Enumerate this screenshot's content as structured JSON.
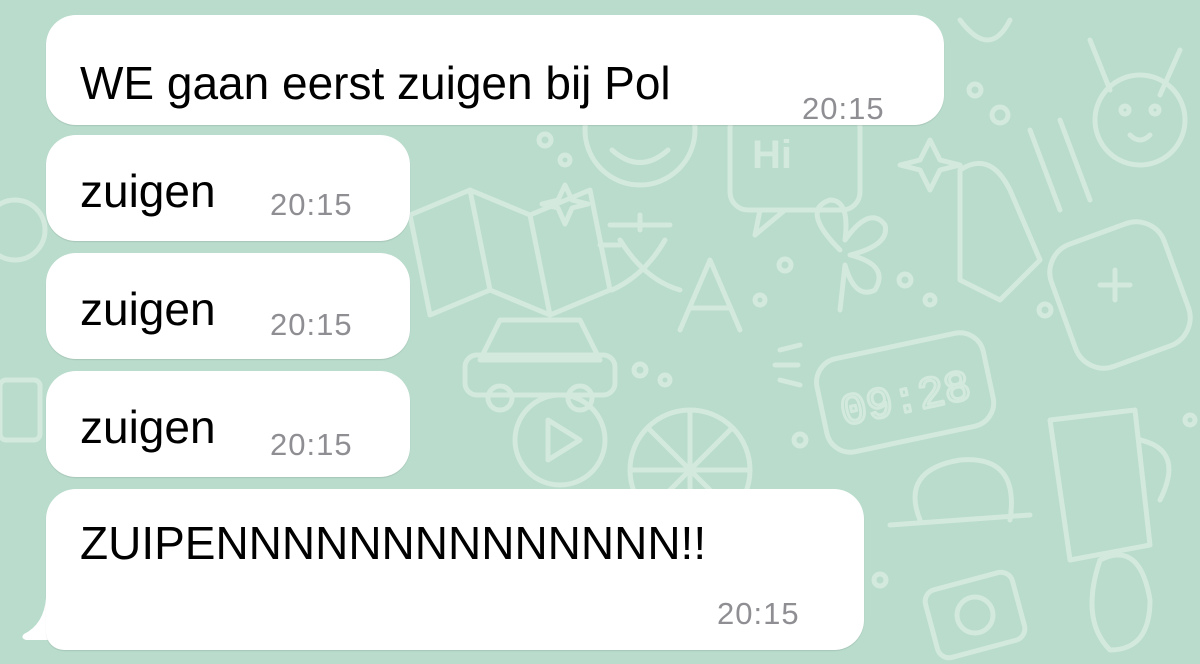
{
  "theme": {
    "wallpaper_color": "#b9dccc",
    "doodle_color": "#d3e9de",
    "bubble_color": "#ffffff",
    "text_color": "#000000",
    "time_color": "#8e8e93"
  },
  "wallpaper": {
    "clock_doodle_text": "09:28",
    "hi_doodle_text": "Hi",
    "letter_doodle_text": "A"
  },
  "messages": [
    {
      "text": "WE gaan eerst zuigen bij Pol",
      "time": "20:15"
    },
    {
      "text": "zuigen",
      "time": "20:15"
    },
    {
      "text": "zuigen",
      "time": "20:15"
    },
    {
      "text": "zuigen",
      "time": "20:15"
    },
    {
      "text": "ZUIPENNNNNNNNNNNNNN!!",
      "time": "20:15"
    }
  ]
}
